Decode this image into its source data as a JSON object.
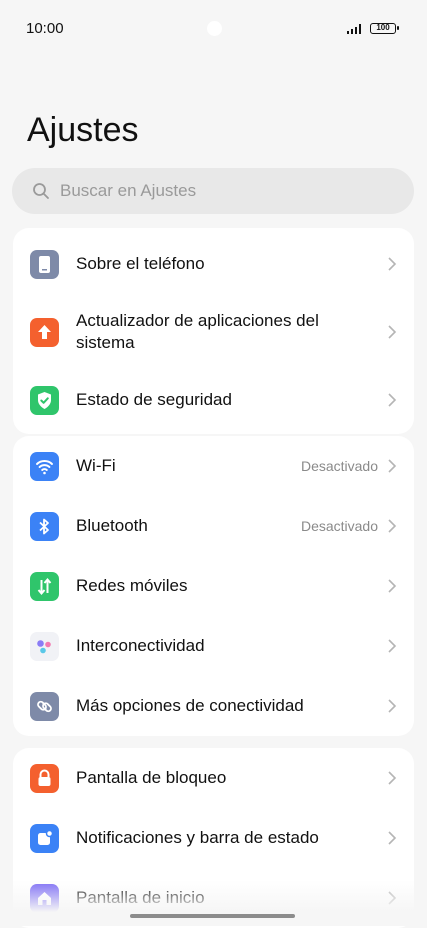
{
  "status": {
    "time": "10:00",
    "battery": "100"
  },
  "page": {
    "title": "Ajustes"
  },
  "search": {
    "placeholder": "Buscar en Ajustes"
  },
  "colors": {
    "background": "#f6f6f6",
    "card": "#ffffff",
    "about_icon": "#7e8aa8",
    "updater_icon": "#f4602e",
    "security_icon": "#2fc56b",
    "wifi_icon": "#3b82f6",
    "bluetooth_icon": "#3b82f6",
    "mobile_icon": "#2fc56b",
    "interconnect_icon": "#f1f2f6",
    "more_icon": "#7e8aa8",
    "lock_icon": "#f4602e",
    "notif_icon": "#3b82f6",
    "home_icon": "#7c6cf5"
  },
  "group1": {
    "about": {
      "label": "Sobre el teléfono",
      "icon": "phone-icon"
    },
    "updater": {
      "label": "Actualizador de aplicaciones del sistema",
      "icon": "upload-arrow-icon"
    },
    "security": {
      "label": "Estado de seguridad",
      "icon": "shield-check-icon"
    }
  },
  "group2": {
    "wifi": {
      "label": "Wi-Fi",
      "value": "Desactivado",
      "icon": "wifi-icon"
    },
    "bluetooth": {
      "label": "Bluetooth",
      "value": "Desactivado",
      "icon": "bluetooth-icon"
    },
    "mobile": {
      "label": "Redes móviles",
      "icon": "mobile-data-icon"
    },
    "interconnect": {
      "label": "Interconectividad",
      "icon": "interconnect-dots-icon"
    },
    "more": {
      "label": "Más opciones de conectividad",
      "icon": "link-icon"
    }
  },
  "group3": {
    "lockscreen": {
      "label": "Pantalla de bloqueo",
      "icon": "lock-icon"
    },
    "notifications": {
      "label": "Notificaciones y barra de estado",
      "icon": "notification-icon"
    },
    "homescreen": {
      "label": "Pantalla de inicio",
      "icon": "home-icon"
    }
  }
}
